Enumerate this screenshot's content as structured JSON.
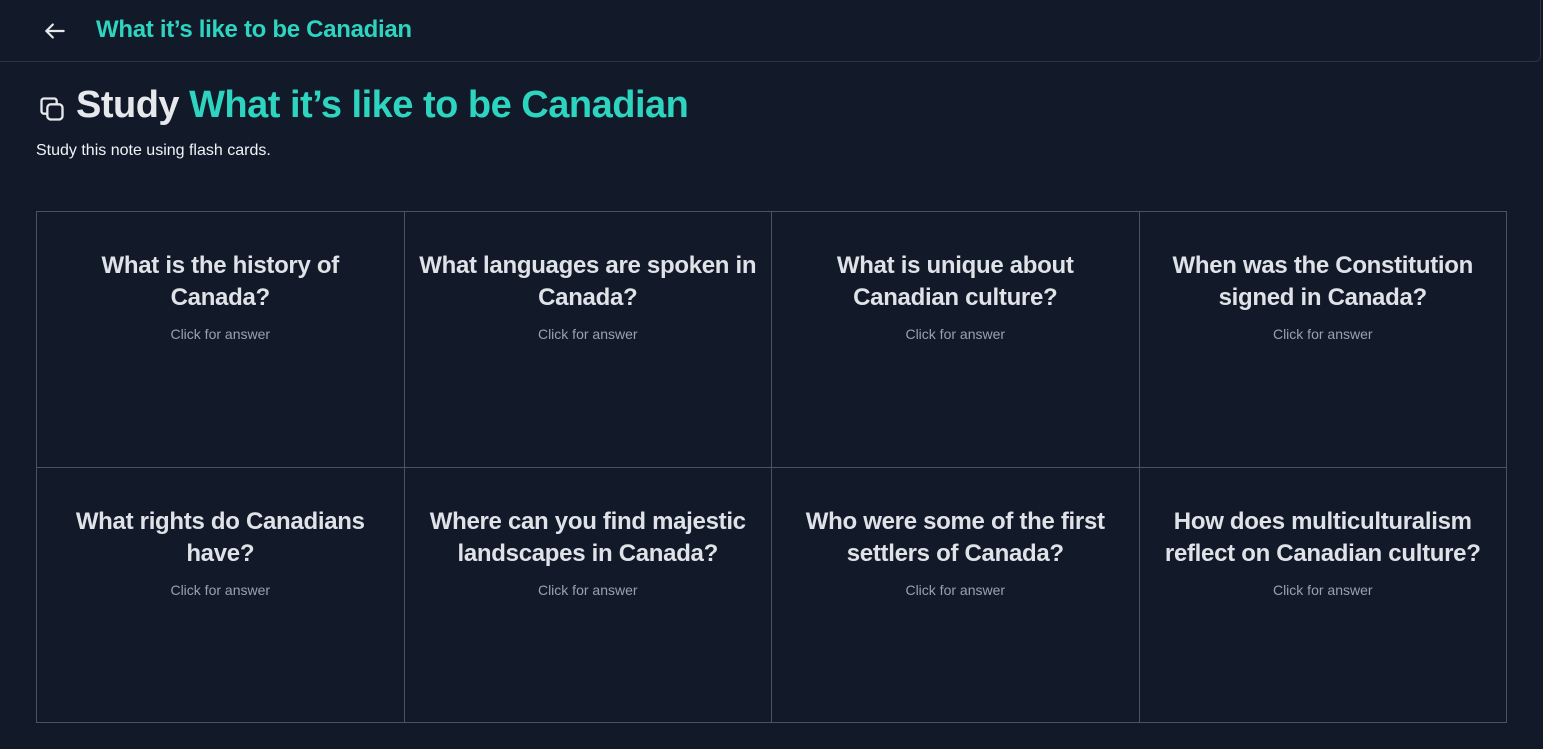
{
  "header": {
    "title": "What it’s like to be Canadian",
    "back_icon": "arrow-left-icon"
  },
  "page": {
    "study_label": "Study",
    "note_title": "What it’s like to be Canadian",
    "subtitle": "Study this note using flash cards.",
    "study_icon": "copy-icon"
  },
  "cards": [
    {
      "question": "What is the history of Canada?",
      "hint": "Click for answer"
    },
    {
      "question": "What languages are spoken in Canada?",
      "hint": "Click for answer"
    },
    {
      "question": "What is unique about Canadian culture?",
      "hint": "Click for answer"
    },
    {
      "question": "When was the Constitution signed in Canada?",
      "hint": "Click for answer"
    },
    {
      "question": "What rights do Canadians have?",
      "hint": "Click for answer"
    },
    {
      "question": "Where can you find majestic landscapes in Canada?",
      "hint": "Click for answer"
    },
    {
      "question": "Who were some of the first settlers of Canada?",
      "hint": "Click for answer"
    },
    {
      "question": "How does multiculturalism reflect on Canadian culture?",
      "hint": "Click for answer"
    }
  ],
  "colors": {
    "background": "#121a2a",
    "accent": "#2dd4bf",
    "border": "#4a5263"
  }
}
